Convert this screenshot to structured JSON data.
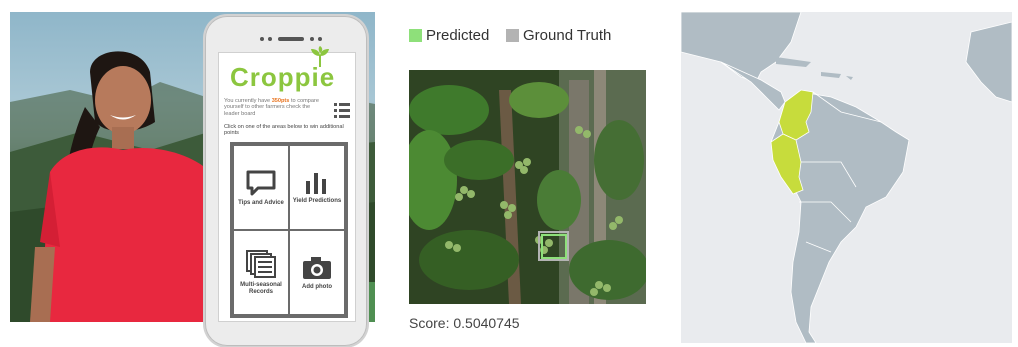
{
  "app": {
    "brand": "Croppie",
    "points_line": [
      "You currently have ",
      "350pts",
      " to compare yourself to other farmers check the leader board"
    ],
    "instruction": "Click on one of the areas below to win additional points",
    "tiles": [
      {
        "label": "Tips and Advice",
        "icon": "speech-bubble-icon"
      },
      {
        "label": "Yield Predictions",
        "icon": "bar-chart-icon"
      },
      {
        "label": "Multi-seasonal Records",
        "icon": "stacked-records-icon"
      },
      {
        "label": "Add photo",
        "icon": "camera-icon"
      }
    ],
    "brand_color": "#8cc63f",
    "points_color": "#e8731e"
  },
  "detection": {
    "legend": [
      {
        "label": "Predicted",
        "color": "#8ee07a"
      },
      {
        "label": "Ground Truth",
        "color": "#b3b3b3"
      }
    ],
    "score_text": "Score: 0.5040745"
  },
  "map": {
    "highlighted_color": "#c7dc3c",
    "land_color": "#b0bcc4",
    "water_color": "#e9ebee"
  }
}
